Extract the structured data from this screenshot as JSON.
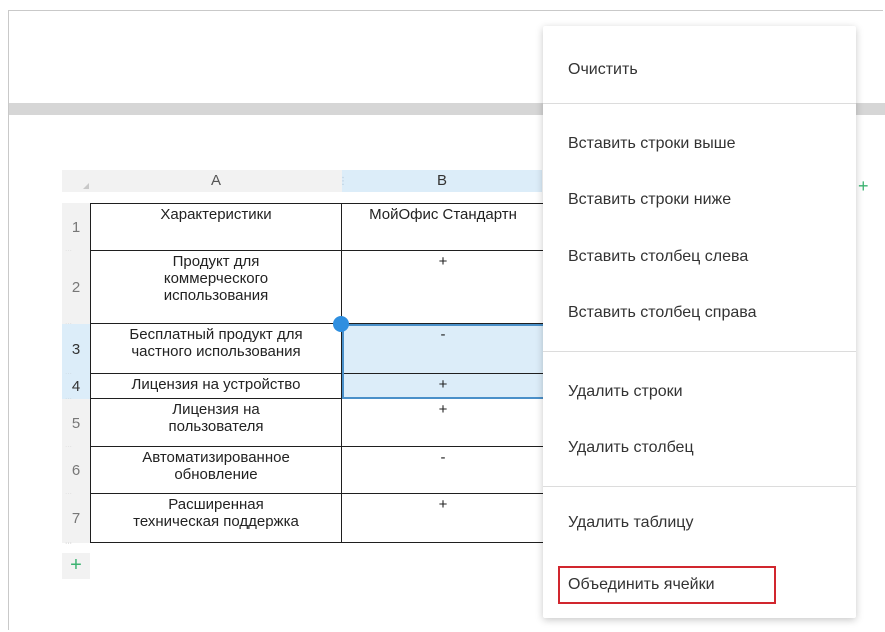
{
  "sheet": {
    "columns": [
      "A",
      "B"
    ],
    "rows": [
      {
        "num": "1",
        "a": "Характеристики",
        "b": "МойОфис Стандартн"
      },
      {
        "num": "2",
        "a": "Продукт для\nкоммерческого\nиспользования",
        "b": "+"
      },
      {
        "num": "3",
        "a": "Бесплатный продукт для\nчастного использования",
        "b": "-"
      },
      {
        "num": "4",
        "a": "Лицензия на устройство",
        "b": "+"
      },
      {
        "num": "5",
        "a": "Лицензия на\nпользователя",
        "b": "+"
      },
      {
        "num": "6",
        "a": "Автоматизированное\nобновление",
        "b": "-"
      },
      {
        "num": "7",
        "a": "Расширенная\nтехническая поддержка",
        "b": "+"
      }
    ],
    "add_row_icon": "+",
    "add_col_icon": "+",
    "selected_rows": [
      "3",
      "4"
    ],
    "selected_column": "B"
  },
  "context_menu": {
    "items": [
      "Очистить",
      "Вставить строки выше",
      "Вставить строки ниже",
      "Вставить столбец слева",
      "Вставить столбец справа",
      "Удалить строки",
      "Удалить столбец",
      "Удалить таблицу",
      "Объединить ячейки"
    ],
    "highlighted_item": "Объединить ячейки",
    "highlight_color": "#d1262e"
  },
  "colors": {
    "selection_fill": "#dcedf9",
    "selection_border": "#4a90c9",
    "add_icon": "#3cb371"
  }
}
